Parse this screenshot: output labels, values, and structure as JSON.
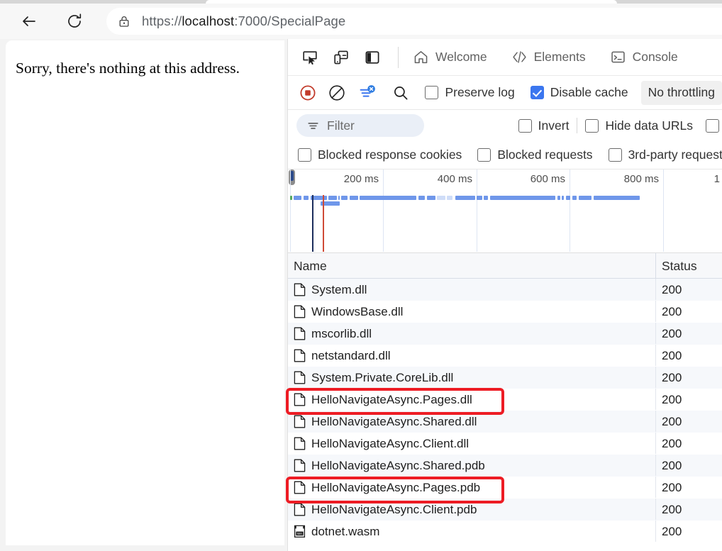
{
  "browser": {
    "back_label": "Back",
    "reload_label": "Refresh",
    "lock_icon": "lock-icon",
    "url_scheme": "https://",
    "url_host": "localhost",
    "url_rest": ":7000/SpecialPage",
    "url_full": "https://localhost:7000/SpecialPage"
  },
  "page": {
    "message": "Sorry, there's nothing at this address."
  },
  "devtools": {
    "left_icons": [
      {
        "name": "inspect-element-icon",
        "title": "Inspect element"
      },
      {
        "name": "device-emulation-icon",
        "title": "Toggle device emulation"
      },
      {
        "name": "dock-side-icon",
        "title": "Dock side"
      }
    ],
    "tabs": [
      {
        "label": "Welcome",
        "icon": "home-icon"
      },
      {
        "label": "Elements",
        "icon": "code-icon"
      },
      {
        "label": "Console",
        "icon": "console-icon"
      }
    ],
    "controls": {
      "record_icon": "record-stop-icon",
      "clear_icon": "clear-icon",
      "filter_toggle_icon": "filter-off-icon",
      "search_icon": "search-icon",
      "preserve_log_label": "Preserve log",
      "preserve_log_checked": false,
      "disable_cache_label": "Disable cache",
      "disable_cache_checked": true,
      "throttling_label": "No throttling"
    },
    "filter": {
      "icon": "filter-icon",
      "placeholder": "Filter",
      "value": "",
      "invert_label": "Invert",
      "invert_checked": false,
      "hide_data_urls_label": "Hide data URLs",
      "hide_data_urls_checked": false,
      "extra_checked": false,
      "blocked_response_cookies_label": "Blocked response cookies",
      "blocked_response_cookies_checked": false,
      "blocked_requests_label": "Blocked requests",
      "blocked_requests_checked": false,
      "third_party_requests_label": "3rd-party request",
      "third_party_requests_checked": false
    },
    "accent_colors": {
      "checkbox_blue": "#3b76ef",
      "record_red": "#c23b2b",
      "annotation_red": "#ed1c24",
      "waterfall_blue": "#6f97ea",
      "dom_content_loaded": "#1c2e5c",
      "load_event": "#cf4a36"
    },
    "overview": {
      "ticks": [
        "200 ms",
        "400 ms",
        "600 ms",
        "800 ms",
        "1"
      ]
    },
    "table": {
      "columns": [
        "Name",
        "Status"
      ],
      "rows": [
        {
          "name": "System.dll",
          "status": "200",
          "icon": "document-icon",
          "highlighted": false
        },
        {
          "name": "WindowsBase.dll",
          "status": "200",
          "icon": "document-icon",
          "highlighted": false
        },
        {
          "name": "mscorlib.dll",
          "status": "200",
          "icon": "document-icon",
          "highlighted": false
        },
        {
          "name": "netstandard.dll",
          "status": "200",
          "icon": "document-icon",
          "highlighted": false
        },
        {
          "name": "System.Private.CoreLib.dll",
          "status": "200",
          "icon": "document-icon",
          "highlighted": false
        },
        {
          "name": "HelloNavigateAsync.Pages.dll",
          "status": "200",
          "icon": "document-icon",
          "highlighted": true
        },
        {
          "name": "HelloNavigateAsync.Shared.dll",
          "status": "200",
          "icon": "document-icon",
          "highlighted": false
        },
        {
          "name": "HelloNavigateAsync.Client.dll",
          "status": "200",
          "icon": "document-icon",
          "highlighted": false
        },
        {
          "name": "HelloNavigateAsync.Shared.pdb",
          "status": "200",
          "icon": "document-icon",
          "highlighted": false
        },
        {
          "name": "HelloNavigateAsync.Pages.pdb",
          "status": "200",
          "icon": "document-icon",
          "highlighted": true
        },
        {
          "name": "HelloNavigateAsync.Client.pdb",
          "status": "200",
          "icon": "document-icon",
          "highlighted": false
        },
        {
          "name": "dotnet.wasm",
          "status": "200",
          "icon": "wasm-icon",
          "highlighted": false
        }
      ]
    }
  }
}
